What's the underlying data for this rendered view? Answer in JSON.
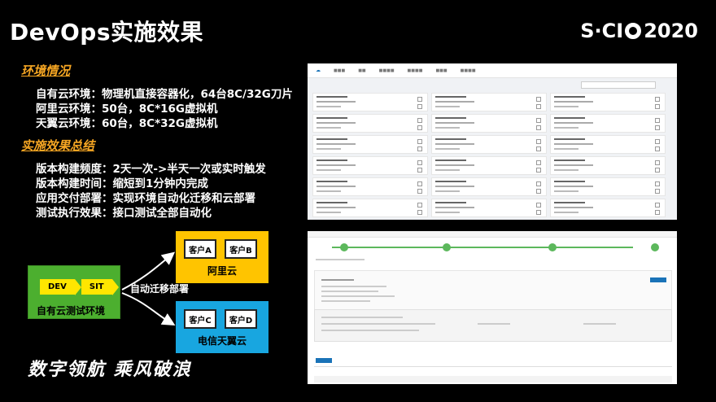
{
  "slide": {
    "title": "DevOps实施效果",
    "logo": {
      "left": "S·CI",
      "right": "2020"
    }
  },
  "env": {
    "heading": "环境情况",
    "lines": [
      "自有云环境：物理机直接容器化，64台8C/32G刀片",
      "阿里云环境：50台，8C*16G虚拟机",
      "天翼云环境：60台，8C*32G虚拟机"
    ]
  },
  "effects": {
    "heading": "实施效果总结",
    "lines": [
      "版本构建频度：2天一次->半天一次或实时触发",
      "版本构建时间：缩短到1分钟内完成",
      "应用交付部署：实现环境自动化迁移和云部署",
      "测试执行效果：接口测试全部自动化"
    ]
  },
  "diagram": {
    "source": {
      "tags": [
        "DEV",
        "SIT"
      ],
      "label": "自有云测试环境"
    },
    "migrate_label": "自动迁移部署",
    "targets": [
      {
        "label": "阿里云",
        "customers": [
          "客户A",
          "客户B"
        ],
        "color": "#ffc400"
      },
      {
        "label": "电信天翼云",
        "customers": [
          "客户C",
          "客户D"
        ],
        "color": "#18a6e0"
      }
    ]
  },
  "slogan": "数字领航 乘风破浪",
  "colors": {
    "accent": "#f6a623",
    "green": "#4caf2f",
    "yellow": "#ffe600"
  }
}
